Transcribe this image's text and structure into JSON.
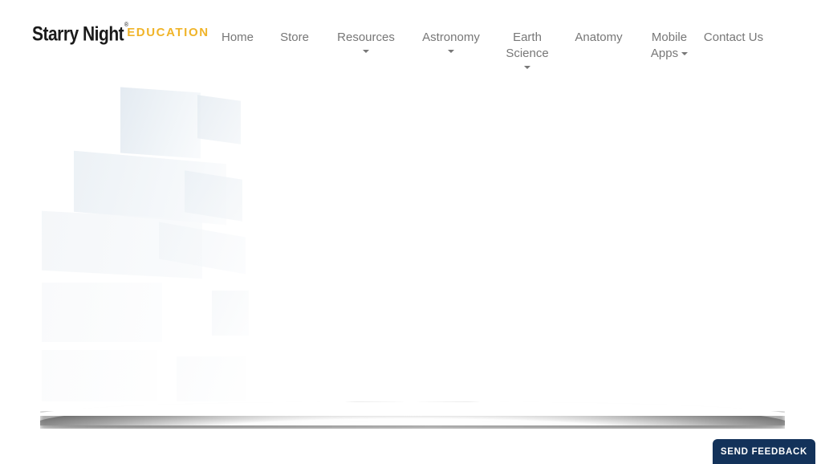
{
  "site": {
    "logo": {
      "brand": "Starry Night",
      "registered_mark": "®",
      "sub_brand": "EDUCATION",
      "brand_color": "#1b1b1b",
      "sub_brand_color": "#f0b429"
    }
  },
  "nav": {
    "items": [
      {
        "label": "Home",
        "has_dropdown": false,
        "caret_position": "none"
      },
      {
        "label": "Store",
        "has_dropdown": false,
        "caret_position": "none"
      },
      {
        "label": "Resources",
        "has_dropdown": true,
        "caret_position": "below"
      },
      {
        "label": "Astronomy",
        "has_dropdown": true,
        "caret_position": "below"
      },
      {
        "label": "Earth Science",
        "has_dropdown": true,
        "caret_position": "below"
      },
      {
        "label": "Anatomy",
        "has_dropdown": false,
        "caret_position": "none"
      },
      {
        "label": "Mobile Apps",
        "has_dropdown": true,
        "caret_position": "inline"
      },
      {
        "label": "Contact Us",
        "has_dropdown": false,
        "caret_position": "none"
      }
    ],
    "text_color": "#777777"
  },
  "hero": {
    "state": "image-loading-faded",
    "background_color": "#ffffff"
  },
  "divider": {
    "style": "curved-page-curl-shadow"
  },
  "feedback": {
    "label": "SEND FEEDBACK",
    "background_color": "#13325a",
    "text_color": "#ffffff"
  }
}
